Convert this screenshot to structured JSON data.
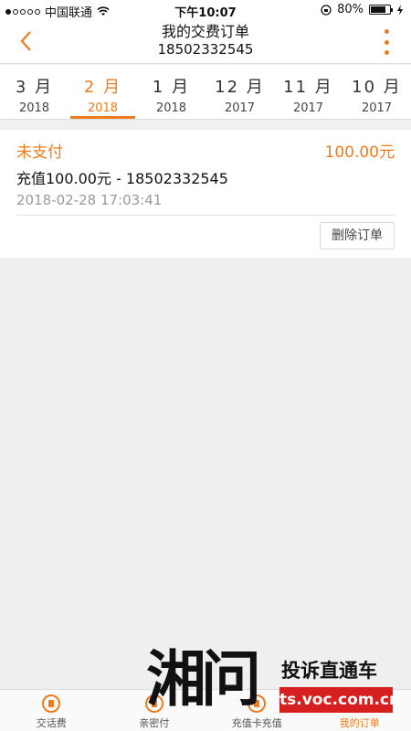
{
  "status_bar": {
    "carrier": "中国联通",
    "time": "下午10:07",
    "battery_text": "80%",
    "battery_level": 0.8
  },
  "navbar": {
    "title": "我的交费订单",
    "subtitle": "18502332545"
  },
  "month_tabs": [
    {
      "month": "3 月",
      "year": "2018",
      "active": false
    },
    {
      "month": "2 月",
      "year": "2018",
      "active": true
    },
    {
      "month": "1 月",
      "year": "2018",
      "active": false
    },
    {
      "month": "12 月",
      "year": "2017",
      "active": false
    },
    {
      "month": "11 月",
      "year": "2017",
      "active": false
    },
    {
      "month": "10 月",
      "year": "2017",
      "active": false
    }
  ],
  "order": {
    "status": "未支付",
    "amount": "100.00元",
    "description": "充值100.00元 - 18502332545",
    "time": "2018-02-28 17:03:41",
    "delete_label": "删除订单"
  },
  "bottom_tabs": [
    {
      "label": "交话费",
      "active": false
    },
    {
      "label": "亲密付",
      "active": false
    },
    {
      "label": "充值卡充值",
      "active": false
    },
    {
      "label": "我的订单",
      "active": true
    }
  ],
  "watermark": {
    "logo": "湘问",
    "slogan": "投诉直通车",
    "url": "ts.voc.com.cn"
  },
  "colors": {
    "accent": "#f07b1d",
    "watermark_red": "#d6201f"
  }
}
